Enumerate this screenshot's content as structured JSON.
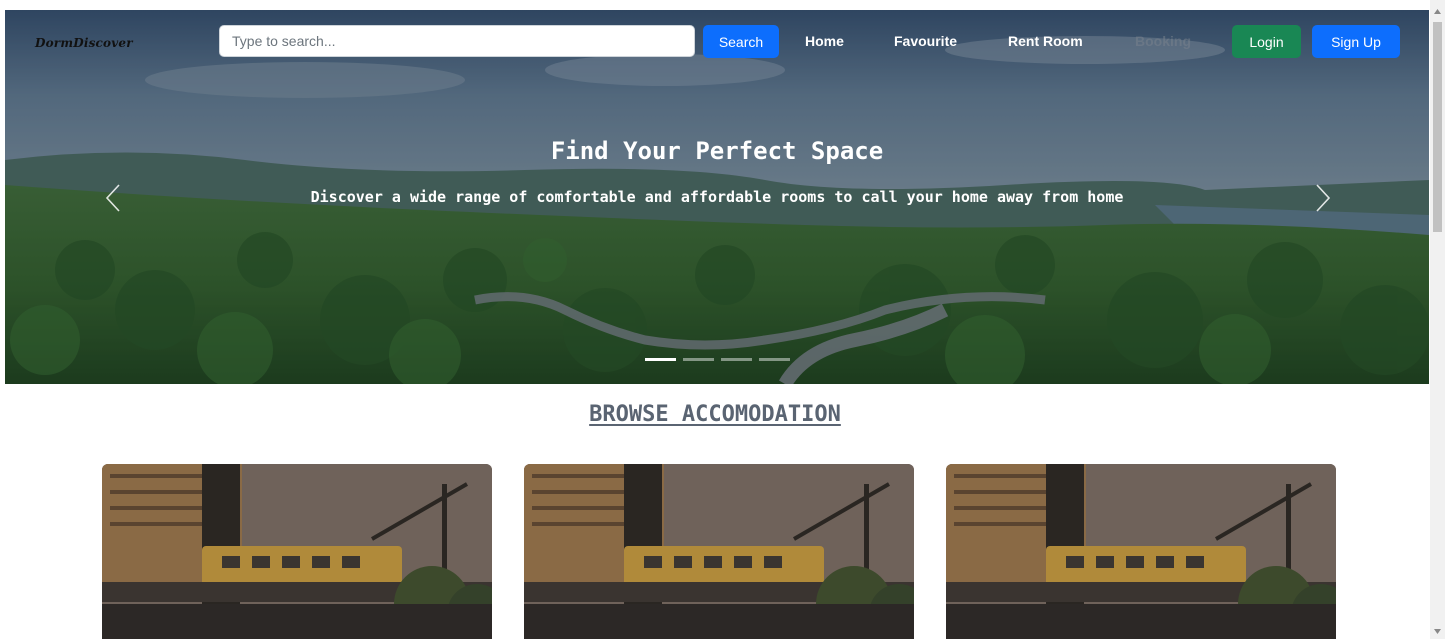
{
  "navbar": {
    "brand": "DormDiscover",
    "search_placeholder": "Type to search...",
    "search_button": "Search",
    "links": [
      {
        "label": "Home"
      },
      {
        "label": "Favourite"
      },
      {
        "label": "Rent Room"
      },
      {
        "label": "Booking"
      }
    ],
    "login_button": "Login",
    "signup_button": "Sign Up"
  },
  "hero": {
    "title": "Find Your Perfect Space",
    "text": "Discover a wide range of comfortable and affordable rooms to call your home away from home",
    "slides_count": 4,
    "active_slide": 1
  },
  "section": {
    "title": "BROWSE ACCOMODATION"
  },
  "colors": {
    "primary": "#0d6efd",
    "success": "#198754",
    "heading": "#5a6472"
  }
}
